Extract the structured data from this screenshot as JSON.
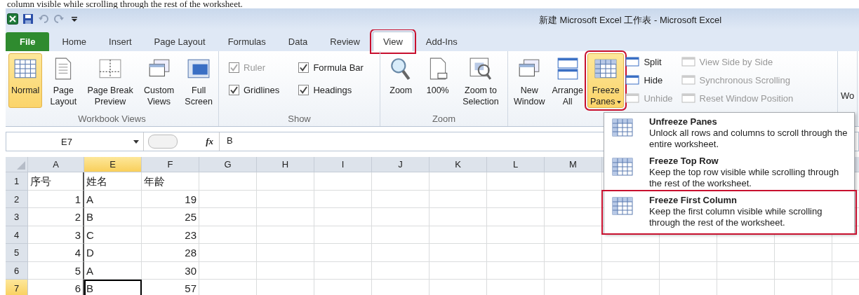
{
  "caption": "column visible while scrolling through the rest of the worksheet.",
  "window": {
    "title": "新建 Microsoft Excel 工作表  -  Microsoft Excel"
  },
  "tabs": [
    {
      "label": "File",
      "kind": "file",
      "selected": false,
      "highlighted": false
    },
    {
      "label": "Home",
      "kind": "tab",
      "selected": false,
      "highlighted": false
    },
    {
      "label": "Insert",
      "kind": "tab",
      "selected": false,
      "highlighted": false
    },
    {
      "label": "Page Layout",
      "kind": "tab",
      "selected": false,
      "highlighted": false
    },
    {
      "label": "Formulas",
      "kind": "tab",
      "selected": false,
      "highlighted": false
    },
    {
      "label": "Data",
      "kind": "tab",
      "selected": false,
      "highlighted": false
    },
    {
      "label": "Review",
      "kind": "tab",
      "selected": false,
      "highlighted": false
    },
    {
      "label": "View",
      "kind": "tab",
      "selected": true,
      "highlighted": true
    },
    {
      "label": "Add-Ins",
      "kind": "tab",
      "selected": false,
      "highlighted": false
    }
  ],
  "ribbon": {
    "groups": [
      {
        "label": "Workbook Views",
        "items": [
          {
            "kind": "large",
            "label": "Normal",
            "selected": true,
            "highlighted": false
          },
          {
            "kind": "large",
            "label": "Page\nLayout",
            "selected": false,
            "highlighted": false
          },
          {
            "kind": "large",
            "label": "Page Break\nPreview",
            "selected": false,
            "highlighted": false
          },
          {
            "kind": "large",
            "label": "Custom\nViews",
            "selected": false,
            "highlighted": false
          },
          {
            "kind": "large",
            "label": "Full\nScreen",
            "selected": false,
            "highlighted": false
          }
        ]
      },
      {
        "label": "Show",
        "items": [
          {
            "kind": "check",
            "label": "Ruler",
            "checked": true,
            "disabled": true
          },
          {
            "kind": "check",
            "label": "Formula Bar",
            "checked": true,
            "disabled": false
          },
          {
            "kind": "check",
            "label": "Gridlines",
            "checked": true,
            "disabled": false
          },
          {
            "kind": "check",
            "label": "Headings",
            "checked": true,
            "disabled": false
          }
        ]
      },
      {
        "label": "Zoom",
        "items": [
          {
            "kind": "large",
            "label": "Zoom",
            "selected": false,
            "highlighted": false
          },
          {
            "kind": "large",
            "label": "100%",
            "selected": false,
            "highlighted": false
          },
          {
            "kind": "large",
            "label": "Zoom to\nSelection",
            "selected": false,
            "highlighted": false
          }
        ]
      },
      {
        "items": [
          {
            "kind": "large",
            "label": "New\nWindow",
            "selected": false,
            "highlighted": false
          },
          {
            "kind": "large",
            "label": "Arrange\nAll",
            "selected": false,
            "highlighted": false
          },
          {
            "kind": "large",
            "label": "Freeze\nPanes",
            "selected": true,
            "highlighted": true,
            "dropdown": true
          },
          {
            "kind": "small",
            "label": "Split",
            "disabled": false
          },
          {
            "kind": "small",
            "label": "Hide",
            "disabled": false
          },
          {
            "kind": "small",
            "label": "Unhide",
            "disabled": true
          },
          {
            "kind": "small",
            "label": "View Side by Side",
            "disabled": true
          },
          {
            "kind": "small",
            "label": "Synchronous Scrolling",
            "disabled": true
          },
          {
            "kind": "small",
            "label": "Reset Window Position",
            "disabled": true
          }
        ]
      },
      {
        "items": [
          {
            "kind": "cut",
            "label": "Wo"
          }
        ]
      }
    ]
  },
  "formula_bar": {
    "name_box": "E7",
    "function_button": "fx",
    "formula": "B"
  },
  "sheet": {
    "columns": [
      {
        "label": "A",
        "selected": false
      },
      {
        "label": "E",
        "selected": true
      },
      {
        "label": "F",
        "selected": false
      },
      {
        "label": "G",
        "selected": false
      },
      {
        "label": "H",
        "selected": false
      },
      {
        "label": "I",
        "selected": false
      },
      {
        "label": "J",
        "selected": false
      },
      {
        "label": "K",
        "selected": false
      },
      {
        "label": "L",
        "selected": false
      },
      {
        "label": "M",
        "selected": false
      }
    ],
    "rows": [
      {
        "header": "1",
        "selected": false,
        "cells": [
          {
            "text": "序号",
            "kind": "text",
            "selected": false
          },
          {
            "text": "姓名",
            "kind": "text",
            "selected": false
          },
          {
            "text": "年龄",
            "kind": "text",
            "selected": false
          }
        ]
      },
      {
        "header": "2",
        "selected": false,
        "cells": [
          {
            "text": "1",
            "kind": "number",
            "selected": false
          },
          {
            "text": "A",
            "kind": "text",
            "selected": false
          },
          {
            "text": "19",
            "kind": "number",
            "selected": false
          }
        ]
      },
      {
        "header": "3",
        "selected": false,
        "cells": [
          {
            "text": "2",
            "kind": "number",
            "selected": false
          },
          {
            "text": "B",
            "kind": "text",
            "selected": false
          },
          {
            "text": "25",
            "kind": "number",
            "selected": false
          }
        ]
      },
      {
        "header": "4",
        "selected": false,
        "cells": [
          {
            "text": "3",
            "kind": "number",
            "selected": false
          },
          {
            "text": "C",
            "kind": "text",
            "selected": false
          },
          {
            "text": "23",
            "kind": "number",
            "selected": false
          }
        ]
      },
      {
        "header": "5",
        "selected": false,
        "cells": [
          {
            "text": "4",
            "kind": "number",
            "selected": false
          },
          {
            "text": "D",
            "kind": "text",
            "selected": false
          },
          {
            "text": "28",
            "kind": "number",
            "selected": false
          }
        ]
      },
      {
        "header": "6",
        "selected": false,
        "cells": [
          {
            "text": "5",
            "kind": "number",
            "selected": false
          },
          {
            "text": "A",
            "kind": "text",
            "selected": false
          },
          {
            "text": "30",
            "kind": "number",
            "selected": false
          }
        ]
      },
      {
        "header": "7",
        "selected": true,
        "cells": [
          {
            "text": "6",
            "kind": "number",
            "selected": false
          },
          {
            "text": "B",
            "kind": "text",
            "selected": true
          },
          {
            "text": "57",
            "kind": "number",
            "selected": false
          }
        ]
      }
    ]
  },
  "menu": {
    "items": [
      {
        "title": "Unfreeze Panes",
        "description": "Unlock all rows and columns to scroll through the entire worksheet.",
        "highlighted": false
      },
      {
        "title": "Freeze Top Row",
        "description": "Keep the top row visible while scrolling through the rest of the worksheet.",
        "highlighted": false
      },
      {
        "title": "Freeze First Column",
        "description": "Keep the first column visible while scrolling through the rest of the worksheet.",
        "highlighted": true
      }
    ]
  }
}
